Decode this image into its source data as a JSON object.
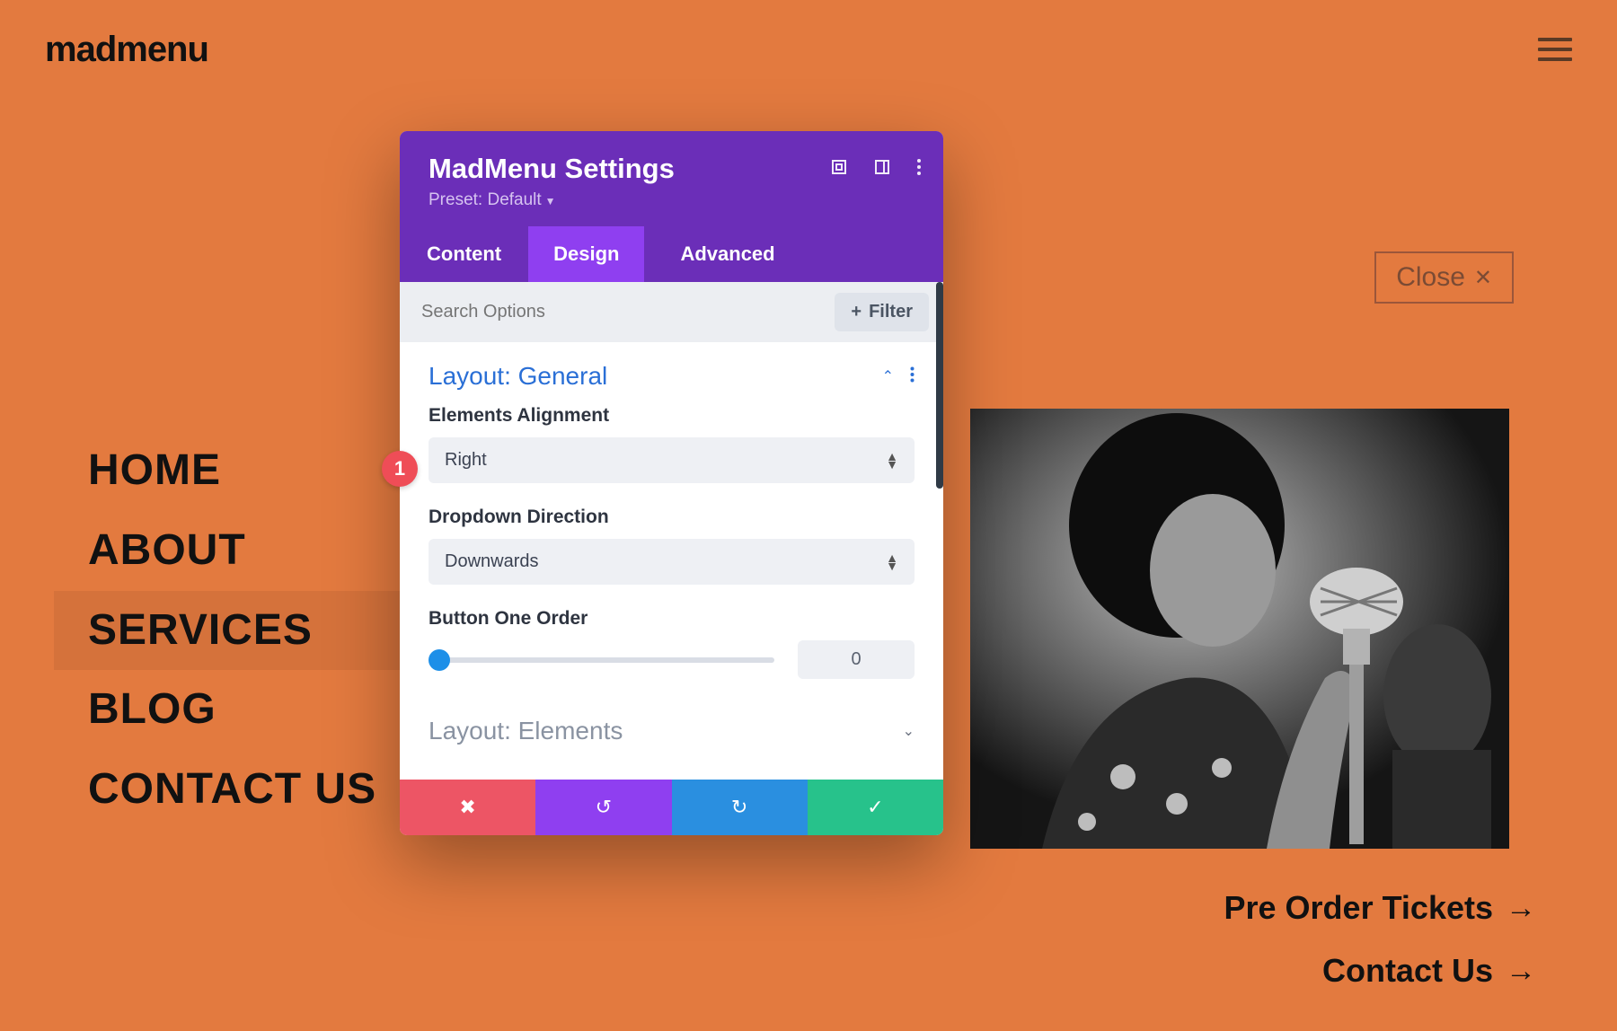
{
  "brand": "madmenu",
  "close_label": "Close",
  "nav": {
    "items": [
      "HOME",
      "ABOUT",
      "SERVICES",
      "BLOG",
      "CONTACT US"
    ],
    "active_index": 2
  },
  "right_links": [
    {
      "label": "Pre Order Tickets"
    },
    {
      "label": "Contact Us"
    }
  ],
  "annotation": {
    "number": "1"
  },
  "modal": {
    "title": "MadMenu Settings",
    "preset_label": "Preset: Default",
    "tabs": [
      "Content",
      "Design",
      "Advanced"
    ],
    "active_tab": 1,
    "search_placeholder": "Search Options",
    "filter_label": "Filter",
    "sections": {
      "general": {
        "title": "Layout: General",
        "fields": {
          "alignment": {
            "label": "Elements Alignment",
            "value": "Right"
          },
          "dropdown": {
            "label": "Dropdown Direction",
            "value": "Downwards"
          },
          "button_order": {
            "label": "Button One Order",
            "value": "0"
          }
        }
      },
      "elements": {
        "title": "Layout: Elements"
      }
    }
  }
}
